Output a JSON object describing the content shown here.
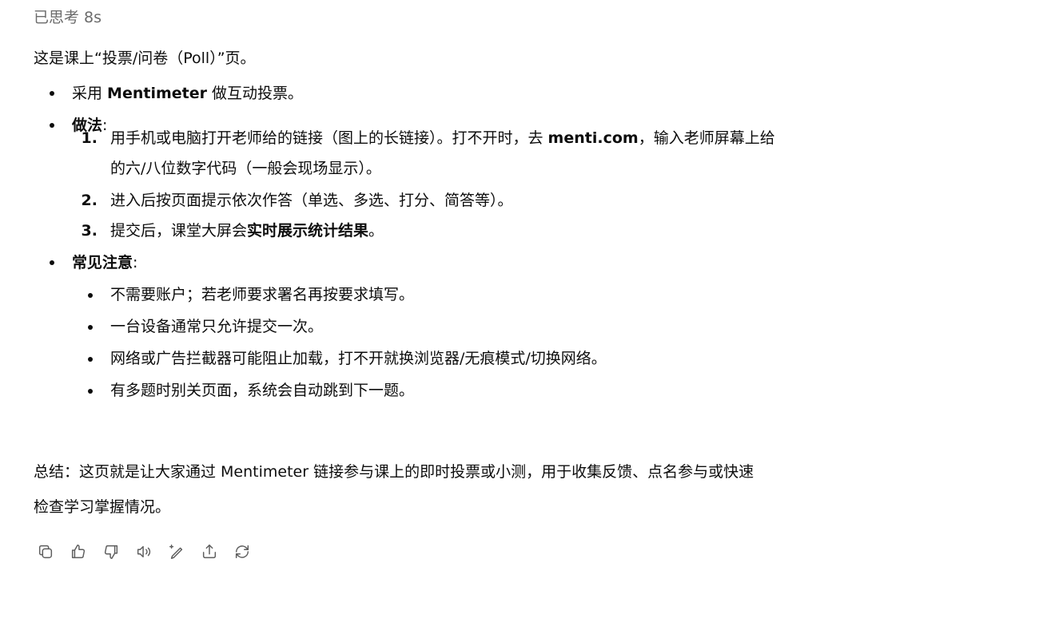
{
  "thought_label": "已思考 8s",
  "intro": "这是课上“投票/问卷（Poll）”页。",
  "bullets": {
    "tool_pre": "采用 ",
    "tool_name": "Mentimeter",
    "tool_post": " 做互动投票。",
    "method_label": "做法",
    "colon": ":"
  },
  "steps": [
    {
      "num": "1.",
      "a": "用手机或电脑打开老师给的链接（图上的长链接）。打不开时，去 ",
      "bold": "menti.com",
      "b": "，输入老师屏幕上给",
      "cont": "的六/八位数字代码（一般会现场显示）。"
    },
    {
      "num": "2.",
      "text": "进入后按页面提示依次作答（单选、多选、打分、简答等）。"
    },
    {
      "num": "3.",
      "pre": "提交后，课堂大屏会",
      "bold": "实时展示统计结果",
      "post": "。"
    }
  ],
  "notes_label": "常见注意",
  "notes": [
    "不需要账户；若老师要求署名再按要求填写。",
    "一台设备通常只允许提交一次。",
    "网络或广告拦截器可能阻止加载，打不开就换浏览器/无痕模式/切换网络。",
    "有多题时别关页面，系统会自动跳到下一题。"
  ],
  "summary": [
    "总结：这页就是让大家通过 Mentimeter 链接参与课上的即时投票或小测，用于收集反馈、点名参与或快速",
    "检查学习掌握情况。"
  ],
  "actions": [
    "copy-icon",
    "thumbs-up-icon",
    "thumbs-down-icon",
    "read-aloud-icon",
    "edit-sparkle-icon",
    "share-icon",
    "regenerate-icon"
  ]
}
